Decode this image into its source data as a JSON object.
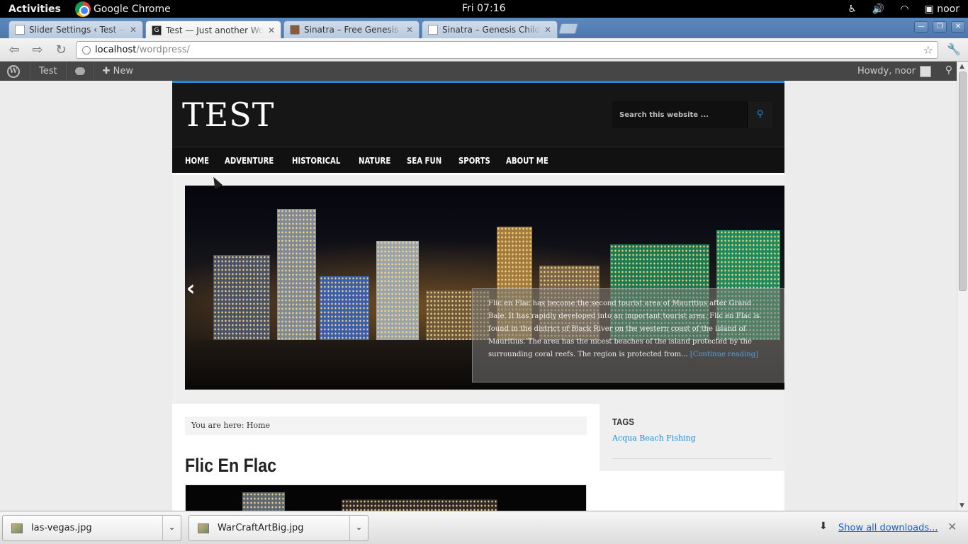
{
  "system": {
    "activities": "Activities",
    "app_name": "Google Chrome",
    "clock": "Fri 07:16",
    "user": "noor"
  },
  "tabs": [
    {
      "title": "Slider Settings ‹ Test — Wo",
      "active": false
    },
    {
      "title": "Test — Just another WordP",
      "active": true
    },
    {
      "title": "Sinatra – Free Genesis Chil",
      "active": false
    },
    {
      "title": "Sinatra – Genesis Child The",
      "active": false
    }
  ],
  "omnibox": {
    "host": "localhost",
    "path": "/wordpress/"
  },
  "adminbar": {
    "site": "Test",
    "new": "New",
    "howdy": "Howdy, noor"
  },
  "site": {
    "title": "TEST",
    "search_placeholder": "Search this website ...",
    "nav": [
      "HOME",
      "ADVENTURE",
      "HISTORICAL",
      "NATURE",
      "SEA FUN",
      "SPORTS",
      "ABOUT ME"
    ],
    "slider": {
      "caption": "Flic en Flac has become the second tourist area of Mauritius after Grand Baie. It has rapidly developed into an important tourist area. Flic en Flac is found in the district of Black River on the western coast of the island of Mauritius. The area has the nicest beaches of the island protected by the surrounding coral reefs. The region is protected from...",
      "more": "[Continue reading]"
    },
    "breadcrumb": "You are here: Home",
    "post_title": "Flic En Flac",
    "sidebar": {
      "widget_title": "TAGS",
      "tag": "Acqua Beach Fishing"
    }
  },
  "downloads": {
    "items": [
      "las-vegas.jpg",
      "WarCraftArtBig.jpg"
    ],
    "show_all": "Show all downloads..."
  }
}
